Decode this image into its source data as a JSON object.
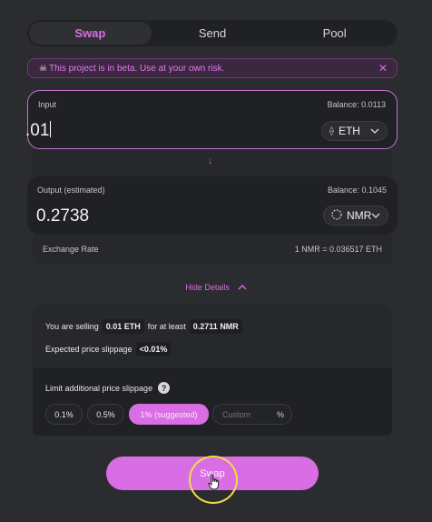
{
  "tabs": [
    {
      "label": "Swap",
      "active": true
    },
    {
      "label": "Send",
      "active": false
    },
    {
      "label": "Pool",
      "active": false
    }
  ],
  "beta_banner": {
    "icon": "skull-icon",
    "text": "This project is in beta. Use at your own risk.",
    "close_icon": "close-icon"
  },
  "input": {
    "label": "Input",
    "balance": "Balance: 0.0113",
    "amount": ".01",
    "token": "ETH"
  },
  "output": {
    "label": "Output (estimated)",
    "balance": "Balance: 0.1045",
    "amount": "0.2738",
    "token": "NMR"
  },
  "exchange_rate": {
    "label": "Exchange Rate",
    "value": "1 NMR = 0.036517 ETH"
  },
  "details_toggle": {
    "label": "Hide Details"
  },
  "details": {
    "selling_prefix": "You are selling",
    "selling_amount": "0.01 ETH",
    "selling_middle": "for at least",
    "min_received": "0.2711 NMR",
    "slippage_label": "Expected price slippage",
    "slippage_value": "<0.01%",
    "limit_label": "Limit additional price slippage",
    "help_icon": "?",
    "options": [
      "0.1%",
      "0.5%",
      "1% (suggested)"
    ],
    "selected_option": "1% (suggested)",
    "custom_placeholder": "Custom",
    "custom_unit": "%"
  },
  "swap_button": {
    "label": "Swap"
  },
  "colors": {
    "accent": "#d96de3",
    "background": "#2b2c30",
    "card": "#202124",
    "click_highlight": "#f2dc44"
  }
}
